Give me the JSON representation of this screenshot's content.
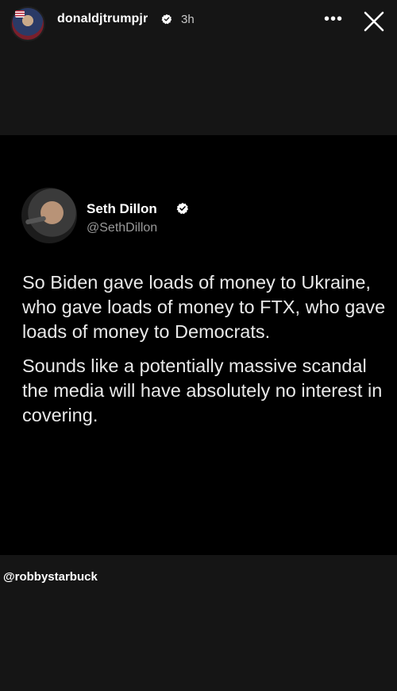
{
  "story": {
    "username": "donaldjtrumpjr",
    "time": "3h",
    "more_label": "•••",
    "mention": "@robbystarbuck"
  },
  "tweet": {
    "name": "Seth Dillon",
    "handle": "@SethDillon",
    "paragraphs": [
      "So Biden gave loads of money to Ukraine, who gave loads of money to FTX, who gave loads of money to Democrats.",
      "Sounds like a potentially massive scandal the media will have absolutely no interest in covering."
    ]
  },
  "icons": {
    "verified": "verified-badge-icon",
    "close": "close-icon",
    "more": "more-options-icon"
  },
  "colors": {
    "story_bg": "#151515",
    "tweet_bg": "#000000",
    "handle": "#9a9a9a"
  }
}
